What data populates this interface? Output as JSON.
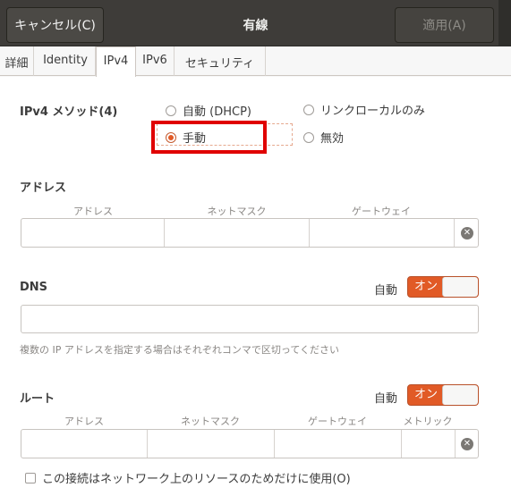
{
  "header": {
    "cancel_label": "キャンセル(C)",
    "title": "有線",
    "apply_label": "適用(A)"
  },
  "tabs": [
    {
      "label": "詳細"
    },
    {
      "label": "Identity"
    },
    {
      "label": "IPv4"
    },
    {
      "label": "IPv6"
    },
    {
      "label": "セキュリティ"
    }
  ],
  "active_tab": "IPv4",
  "ipv4": {
    "method_label": "IPv4 メソッド(4)",
    "methods": [
      {
        "label": "自動 (DHCP)",
        "selected": false
      },
      {
        "label": "リンクローカルのみ",
        "selected": false
      },
      {
        "label": "手動",
        "selected": true
      },
      {
        "label": "無効",
        "selected": false
      }
    ]
  },
  "addresses": {
    "section_label": "アドレス",
    "columns": [
      "アドレス",
      "ネットマスク",
      "ゲートウェイ"
    ],
    "row": [
      "",
      "",
      ""
    ]
  },
  "dns": {
    "section_label": "DNS",
    "auto_label": "自動",
    "toggle_label": "オン",
    "value": "",
    "hint": "複数の IP アドレスを指定する場合はそれぞれコンマで区切ってください"
  },
  "routes": {
    "section_label": "ルート",
    "auto_label": "自動",
    "toggle_label": "オン",
    "columns": [
      "アドレス",
      "ネットマスク",
      "ゲートウェイ",
      "メトリック"
    ],
    "row": [
      "",
      "",
      "",
      ""
    ]
  },
  "only_local_checkbox": {
    "label": "この接続はネットワーク上のリソースのためだけに使用(O)",
    "checked": false
  },
  "colors": {
    "accent": "#e15a26",
    "header_bg": "#3e3c39",
    "highlight": "#e00000"
  }
}
